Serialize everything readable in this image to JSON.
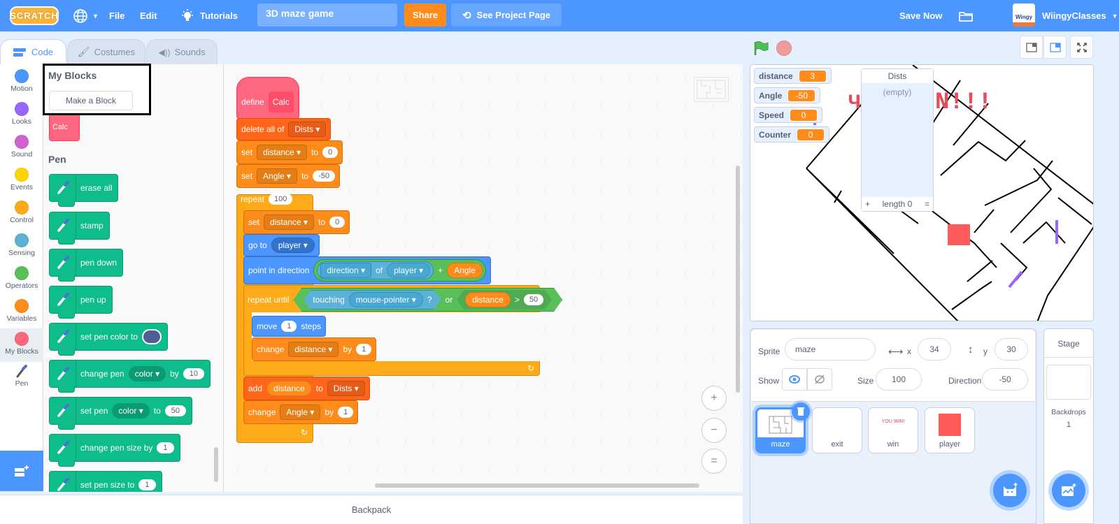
{
  "menubar": {
    "logo": "SCRATCH",
    "file": "File",
    "edit": "Edit",
    "tutorials": "Tutorials",
    "project_title": "3D maze game",
    "share": "Share",
    "see_project_page": "See Project Page",
    "save_now": "Save Now",
    "avatar_text": "Wingy",
    "username": "WiingyClasses"
  },
  "tabs": [
    {
      "label": "Code",
      "icon": "code-icon"
    },
    {
      "label": "Costumes",
      "icon": "brush-icon"
    },
    {
      "label": "Sounds",
      "icon": "speaker-icon"
    }
  ],
  "categories": [
    {
      "label": "Motion",
      "color": "#4c97ff"
    },
    {
      "label": "Looks",
      "color": "#9966ff"
    },
    {
      "label": "Sound",
      "color": "#cf63cf"
    },
    {
      "label": "Events",
      "color": "#ffd500"
    },
    {
      "label": "Control",
      "color": "#ffab19"
    },
    {
      "label": "Sensing",
      "color": "#5cb1d6"
    },
    {
      "label": "Operators",
      "color": "#59c059"
    },
    {
      "label": "Variables",
      "color": "#ff8c1a"
    },
    {
      "label": "My Blocks",
      "color": "#ff6680"
    },
    {
      "label": "Pen",
      "color": "#0fbd8c"
    }
  ],
  "palette": {
    "my_blocks_heading": "My Blocks",
    "make_block": "Make a Block",
    "calc_block": "Calc",
    "pen_heading": "Pen",
    "pen_blocks": [
      {
        "text": "erase all"
      },
      {
        "text": "stamp"
      },
      {
        "text": "pen down"
      },
      {
        "text": "pen up"
      },
      {
        "text": "set pen color to",
        "swatch": "#4d5f95"
      },
      {
        "text": "change pen",
        "dropdown": "color",
        "mid": "by",
        "value": "10"
      },
      {
        "text": "set pen",
        "dropdown": "color",
        "mid": "to",
        "value": "50"
      },
      {
        "text": "change pen size by",
        "value": "1"
      },
      {
        "text": "set pen size to",
        "value": "1"
      }
    ]
  },
  "script": {
    "define": "define",
    "define_name": "Calc",
    "delete_all": "delete all of",
    "list_name": "Dists",
    "set": "set",
    "to": "to",
    "by": "by",
    "change": "change",
    "var_distance": "distance",
    "var_angle": "Angle",
    "set_distance_value": "0",
    "set_angle_value": "-50",
    "repeat": "repeat",
    "repeat_count": "100",
    "inner_set_value": "0",
    "go_to": "go to",
    "go_to_target": "player",
    "point_in_direction": "point in direction",
    "sensing_attr": "direction",
    "of": "of",
    "sensing_obj": "player",
    "plus": "+",
    "angle_reporter": "Angle",
    "repeat_until": "repeat until",
    "touching": "touching",
    "touching_target": "mouse-pointer",
    "question": "?",
    "or": "or",
    "distance_reporter": "distance",
    "gt": ">",
    "gt_value": "50",
    "move": "move",
    "move_value": "1",
    "steps": "steps",
    "change_distance_value": "1",
    "add": "add",
    "add_reporter": "distance",
    "change_angle_value": "1"
  },
  "zoom_controls": {
    "zoom_in": "+",
    "zoom_out": "−",
    "reset": "="
  },
  "backpack": "Backpack",
  "stage": {
    "monitors": [
      {
        "label": "distance",
        "value": "3"
      },
      {
        "label": "Angle",
        "value": "-50"
      },
      {
        "label": "Speed",
        "value": "0"
      },
      {
        "label": "Counter",
        "value": "0"
      }
    ],
    "list_monitor": {
      "title": "Dists",
      "empty": "(empty)",
      "add": "+",
      "length": "length 0",
      "resize": "="
    }
  },
  "sprite_info": {
    "sprite_label": "Sprite",
    "sprite_name": "maze",
    "x_label": "x",
    "x": "34",
    "y_label": "y",
    "y": "30",
    "show_label": "Show",
    "size_label": "Size",
    "size": "100",
    "direction_label": "Direction",
    "direction": "-50"
  },
  "sprites": [
    {
      "name": "maze",
      "selected": true
    },
    {
      "name": "exit"
    },
    {
      "name": "win",
      "thumb_text": "YOU WIN!"
    },
    {
      "name": "player"
    }
  ],
  "stage_panel": {
    "title": "Stage",
    "backdrops_label": "Backdrops",
    "backdrops_count": "1"
  }
}
